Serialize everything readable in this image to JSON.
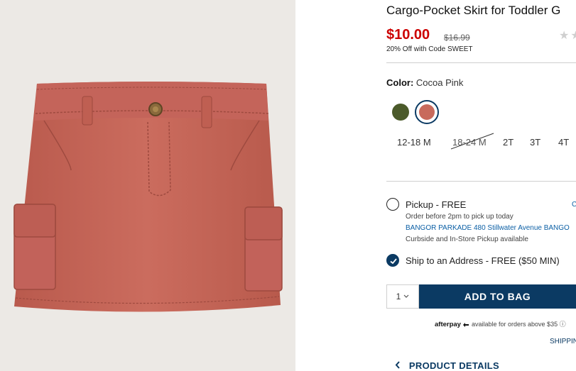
{
  "product": {
    "title": "Cargo-Pocket Skirt for Toddler G",
    "price": "$10.00",
    "original_price": "$16.99",
    "promo": "20% Off with Code SWEET",
    "rating_icon": "star-icon",
    "rating_stars": "★★"
  },
  "color": {
    "label": "Color:",
    "selected": "Cocoa Pink",
    "swatches": [
      {
        "name": "olive",
        "hex": "#4b5a2a"
      },
      {
        "name": "cocoa pink",
        "hex": "#c86a5c"
      }
    ]
  },
  "sizes": [
    {
      "label": "12-18 M",
      "available": true
    },
    {
      "label": "18-24 M",
      "available": false
    },
    {
      "label": "2T",
      "available": true
    },
    {
      "label": "3T",
      "available": true
    },
    {
      "label": "4T",
      "available": true
    }
  ],
  "fulfillment": {
    "pickup": {
      "title": "Pickup - FREE",
      "note": "Order before 2pm to pick up today",
      "store": "BANGOR PARKADE 480 Stillwater Avenue  BANGO",
      "options": "Curbside and In-Store Pickup available",
      "change": "C"
    },
    "ship": {
      "title": "Ship to an Address - FREE ($50 MIN)"
    }
  },
  "cart": {
    "qty": "1",
    "add_label": "ADD TO BAG"
  },
  "afterpay": {
    "brand": "afterpay",
    "text": "available for orders above $35",
    "info": "ⓘ"
  },
  "shipping_link": "SHIPPIN",
  "details_label": "PRODUCT DETAILS",
  "colors": {
    "accent": "#0b3a63",
    "price": "#cc0000",
    "skirt": "#c86a5c"
  }
}
